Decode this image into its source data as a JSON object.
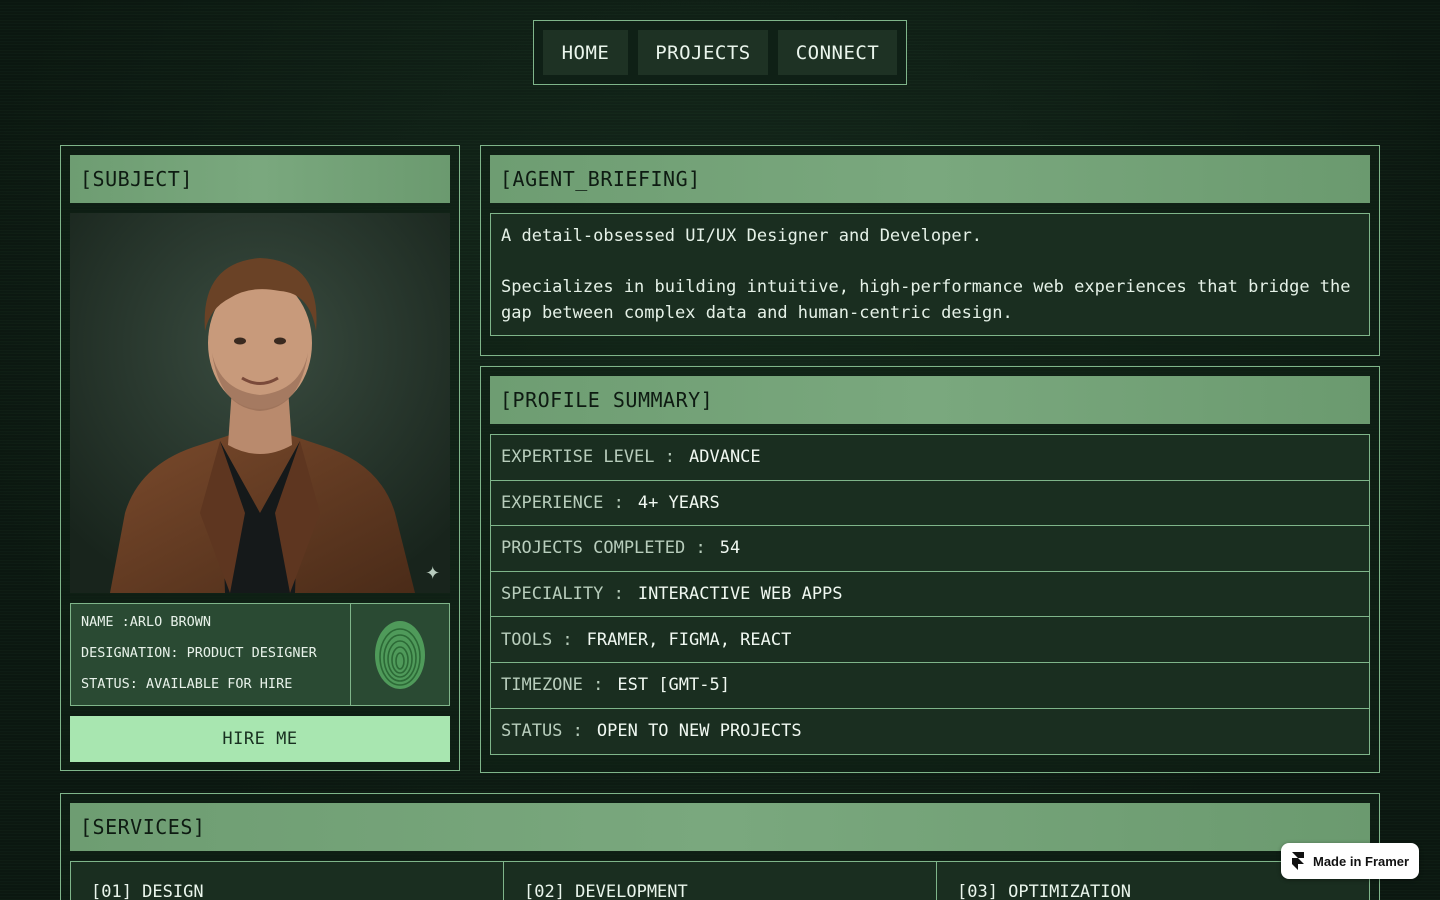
{
  "nav": {
    "items": [
      {
        "label": "HOME"
      },
      {
        "label": "PROJECTS"
      },
      {
        "label": "CONNECT"
      }
    ]
  },
  "subject": {
    "header": "[SUBJECT]",
    "name_line": "NAME :ARLO BROWN",
    "designation_line": "DESIGNATION: PRODUCT DESIGNER",
    "status_line": "STATUS: AVAILABLE FOR HIRE",
    "hire_label": "HIRE ME"
  },
  "briefing": {
    "header": "[AGENT_BRIEFING]",
    "line1": "A detail-obsessed UI/UX Designer and Developer.",
    "line2": "Specializes in building intuitive, high-performance web experiences that bridge the gap between complex data and human-centric design."
  },
  "profile": {
    "header": "[PROFILE SUMMARY]",
    "rows": [
      {
        "label": "EXPERTISE LEVEL :",
        "value": "ADVANCE"
      },
      {
        "label": "EXPERIENCE :",
        "value": "4+ YEARS"
      },
      {
        "label": "PROJECTS COMPLETED :",
        "value": "54"
      },
      {
        "label": "SPECIALITY :",
        "value": "INTERACTIVE WEB APPS"
      },
      {
        "label": "TOOLS :",
        "value": "FRAMER, FIGMA, REACT"
      },
      {
        "label": "TIMEZONE :",
        "value": "EST [GMT-5]"
      },
      {
        "label": "STATUS :",
        "value": "OPEN TO NEW PROJECTS"
      }
    ]
  },
  "services": {
    "header": "[SERVICES]",
    "items": [
      {
        "label": "[01] DESIGN"
      },
      {
        "label": "[02] DEVELOPMENT"
      },
      {
        "label": "[03] OPTIMIZATION"
      }
    ]
  },
  "badge": {
    "label": "Made in Framer"
  },
  "icons": {
    "sparkle": "sparkle-icon",
    "fingerprint": "fingerprint-icon",
    "framer": "framer-logo-icon"
  },
  "colors": {
    "accent": "#7fb58a",
    "header_bg": "#75a479",
    "button_bg": "#a8e6b0",
    "page_bg": "#0c1a11"
  }
}
